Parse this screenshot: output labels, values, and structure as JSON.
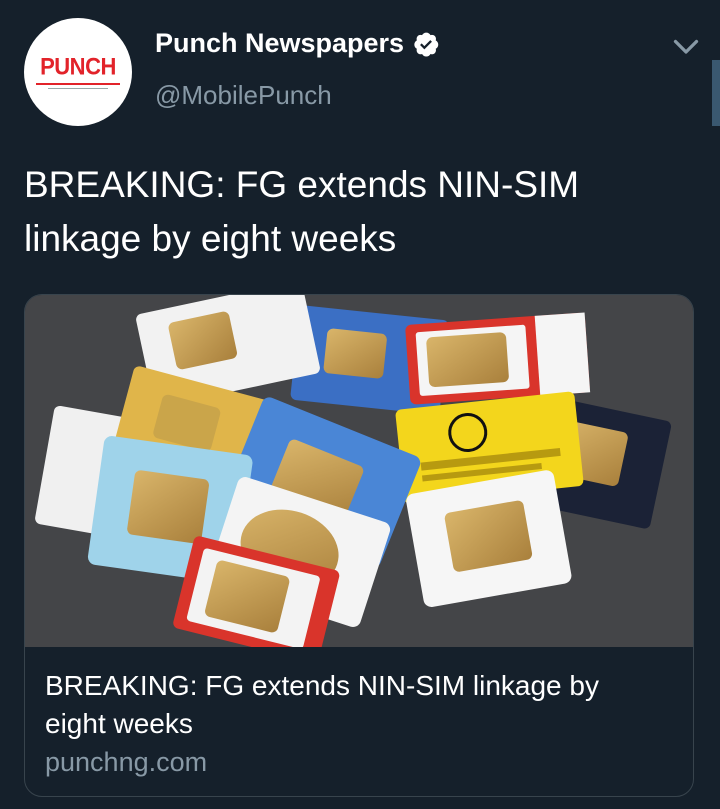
{
  "author": {
    "avatar_logo_text": "PUNCH",
    "display_name": "Punch Newspapers",
    "handle": "@MobilePunch",
    "verified": true
  },
  "tweet": {
    "text": "BREAKING: FG extends NIN-SIM linkage by eight weeks"
  },
  "card": {
    "title": "BREAKING: FG extends NIN-SIM linkage by eight weeks",
    "domain": "punchng.com",
    "image_description_icon": "sim-cards-photo"
  },
  "colors": {
    "background": "#15202b",
    "text_primary": "#ffffff",
    "text_secondary": "#8899a6",
    "border": "#38444d",
    "brand_red": "#e2232a",
    "verified_blue": "#ffffff"
  },
  "icons": {
    "verified": "verified-badge-icon",
    "menu": "chevron-down-icon"
  }
}
